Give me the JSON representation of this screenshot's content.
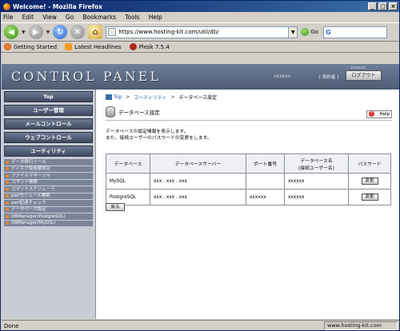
{
  "window": {
    "title": "Welcome! - Mozilla Firefox"
  },
  "menubar": {
    "items": [
      "File",
      "Edit",
      "View",
      "Go",
      "Bookmarks",
      "Tools",
      "Help"
    ]
  },
  "navbar": {
    "url": "https://www.hosting-kit.com/util/db/",
    "go_label": "Go"
  },
  "bookmarks": {
    "items": [
      "Getting Started",
      "Latest Headlines",
      "Plesk 7.5.4"
    ]
  },
  "header": {
    "logo": "CONTROL PANEL",
    "user_id": "xxxxxx",
    "user_id2": "xxxxxx",
    "contract_link": "[ 契約者 ]",
    "logout": "ログアウト"
  },
  "sidebar": {
    "top": "Top",
    "users": "ユーザー管理",
    "mail": "メールコントロール",
    "web": "ウェブコントロール",
    "utility": "ユーティリティ",
    "sub_items": [
      "データ移行ツール",
      "ディスク使用量設定",
      "ファイルマネージャ",
      "コマンド検索",
      "コマンドスケジューラ",
      "perlモジュール検索",
      "perl記述チェック",
      "データベース設定",
      "DBManager(PostgreSQL)",
      "DBManager(MySQL)"
    ]
  },
  "breadcrumb": {
    "top": "Top",
    "sep1": ">",
    "utility": "ユーティリティ",
    "sep2": ">",
    "current": "データベース設定"
  },
  "page": {
    "title": "データベース設定",
    "help": "Help",
    "description_1": "データベースの設定情報を表示します。",
    "description_2": "また、接続ユーザーのパスワードの変更をします。",
    "back": "戻る"
  },
  "table": {
    "headers": [
      "データベース",
      "データベースサーバー",
      "ポート番号",
      "データベース名\n(接続ユーザー名)",
      "パスワード"
    ],
    "rows": [
      {
        "db": "MySQL",
        "server": "xxx . xxx . xxx",
        "port": "",
        "name": "xxxxxx",
        "button": "変更"
      },
      {
        "db": "PostgreSQL",
        "server": "xxx . xxx . xxx",
        "port": "xxxxxx",
        "name": "xxxxxx",
        "button": "変更"
      }
    ]
  },
  "status": {
    "text": "Done",
    "host": "www.hosting-kit.com"
  }
}
